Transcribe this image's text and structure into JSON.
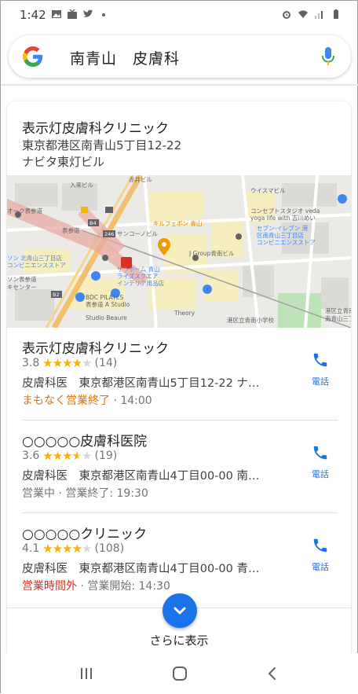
{
  "status_bar": {
    "time": "1:42"
  },
  "search": {
    "query": "南青山　皮膚科"
  },
  "featured": {
    "name": "表示灯皮膚科クリニック",
    "address_line1": "東京都港区南青山5丁目12-22",
    "address_line2": "ナビタ東灯ビル"
  },
  "map": {
    "labels": {
      "kiyohara": "入来ビル",
      "akaidou": "赤井ビル",
      "weissbill": "ウイスマビル",
      "okuomote": "オーク表参道",
      "omotesando": "表参道",
      "kirufebon": "キルフェボン 青山",
      "concept": "コンセプトスタジオ veda",
      "yoga": "yoga life with 吉川めい",
      "seven1": "セブン-イレブン 港",
      "seven2": "区南青山三丁目店",
      "conveni1": "コンビニエンスストア",
      "sanko": "サンコーノビル",
      "lawson1": "ソン 北青山三丁目店",
      "zara1": "ザラホーム 青山",
      "zara2": "ライズスクエア",
      "zara3": "インテリア用品店",
      "jgroup": "J Group青南ビル",
      "sando": "ソン表参道",
      "kiyoko": "キセンター",
      "bdc": "BDC PILATES",
      "bdc2": "表参道 A Studio",
      "beaure": "Studio Beaure",
      "theory": "Theory",
      "school": "港区立青南小学校",
      "school2": "港区立青南幼稚園",
      "mc": "南青山三丁目",
      "b2": "B2",
      "b4": "B4",
      "n246": "246"
    }
  },
  "listings": [
    {
      "name": "表示灯皮膚科クリニック",
      "rating": "3.8",
      "rating_fraction": 0.76,
      "reviews": "(14)",
      "detail": "皮膚科医　東京都港区南青山5丁目12-22 ナ…",
      "status": "まもなく営業終了",
      "status_color": "#e37400",
      "separator": "·",
      "time": "14:00",
      "call_label": "電話"
    },
    {
      "name": "○○○○○皮膚科医院",
      "rating": "3.6",
      "rating_fraction": 0.72,
      "reviews": "(19)",
      "detail": "皮膚科医　東京都港区南青山4丁目00-00 南…",
      "status": "営業中",
      "status_color": "#70757a",
      "separator": "·",
      "time": "営業終了: 19:30",
      "call_label": "電話"
    },
    {
      "name": "○○○○○クリニック",
      "rating": "4.1",
      "rating_fraction": 0.82,
      "reviews": "(108)",
      "detail": "皮膚科医　東京都港区南青山4丁目00-00 青…",
      "status": "営業時間外",
      "status_color": "#d93025",
      "separator": "·",
      "time": "営業開始: 14:30",
      "call_label": "電話"
    }
  ],
  "more": {
    "label": "さらに表示"
  },
  "colors": {
    "accent": "#1a73e8",
    "star": "#f4b400",
    "closing_soon": "#e37400",
    "closed": "#d93025"
  }
}
